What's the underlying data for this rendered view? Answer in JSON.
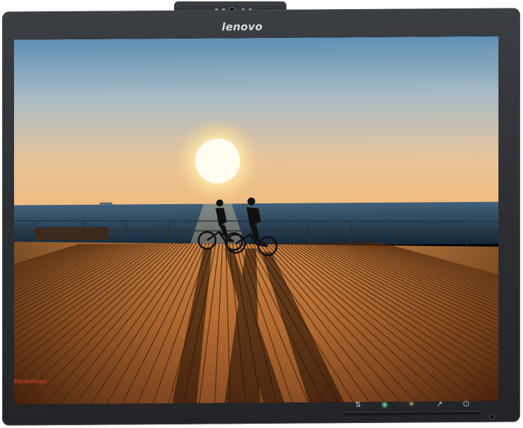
{
  "monitor": {
    "brand_top": "lenovo",
    "brand_bottom": "ThinkVision"
  },
  "screen": {
    "scene": "sunset-boardwalk-cyclists",
    "sky_top": "#5f8fb4",
    "sky_horizon": "#f0bb7e",
    "sea": "#1f3a4f",
    "boardwalk": "#b56a2e"
  },
  "controls": {
    "icons": [
      "input-select-icon",
      "menu-icon",
      "brightness-icon",
      "auto-adjust-icon",
      "power-icon"
    ]
  }
}
